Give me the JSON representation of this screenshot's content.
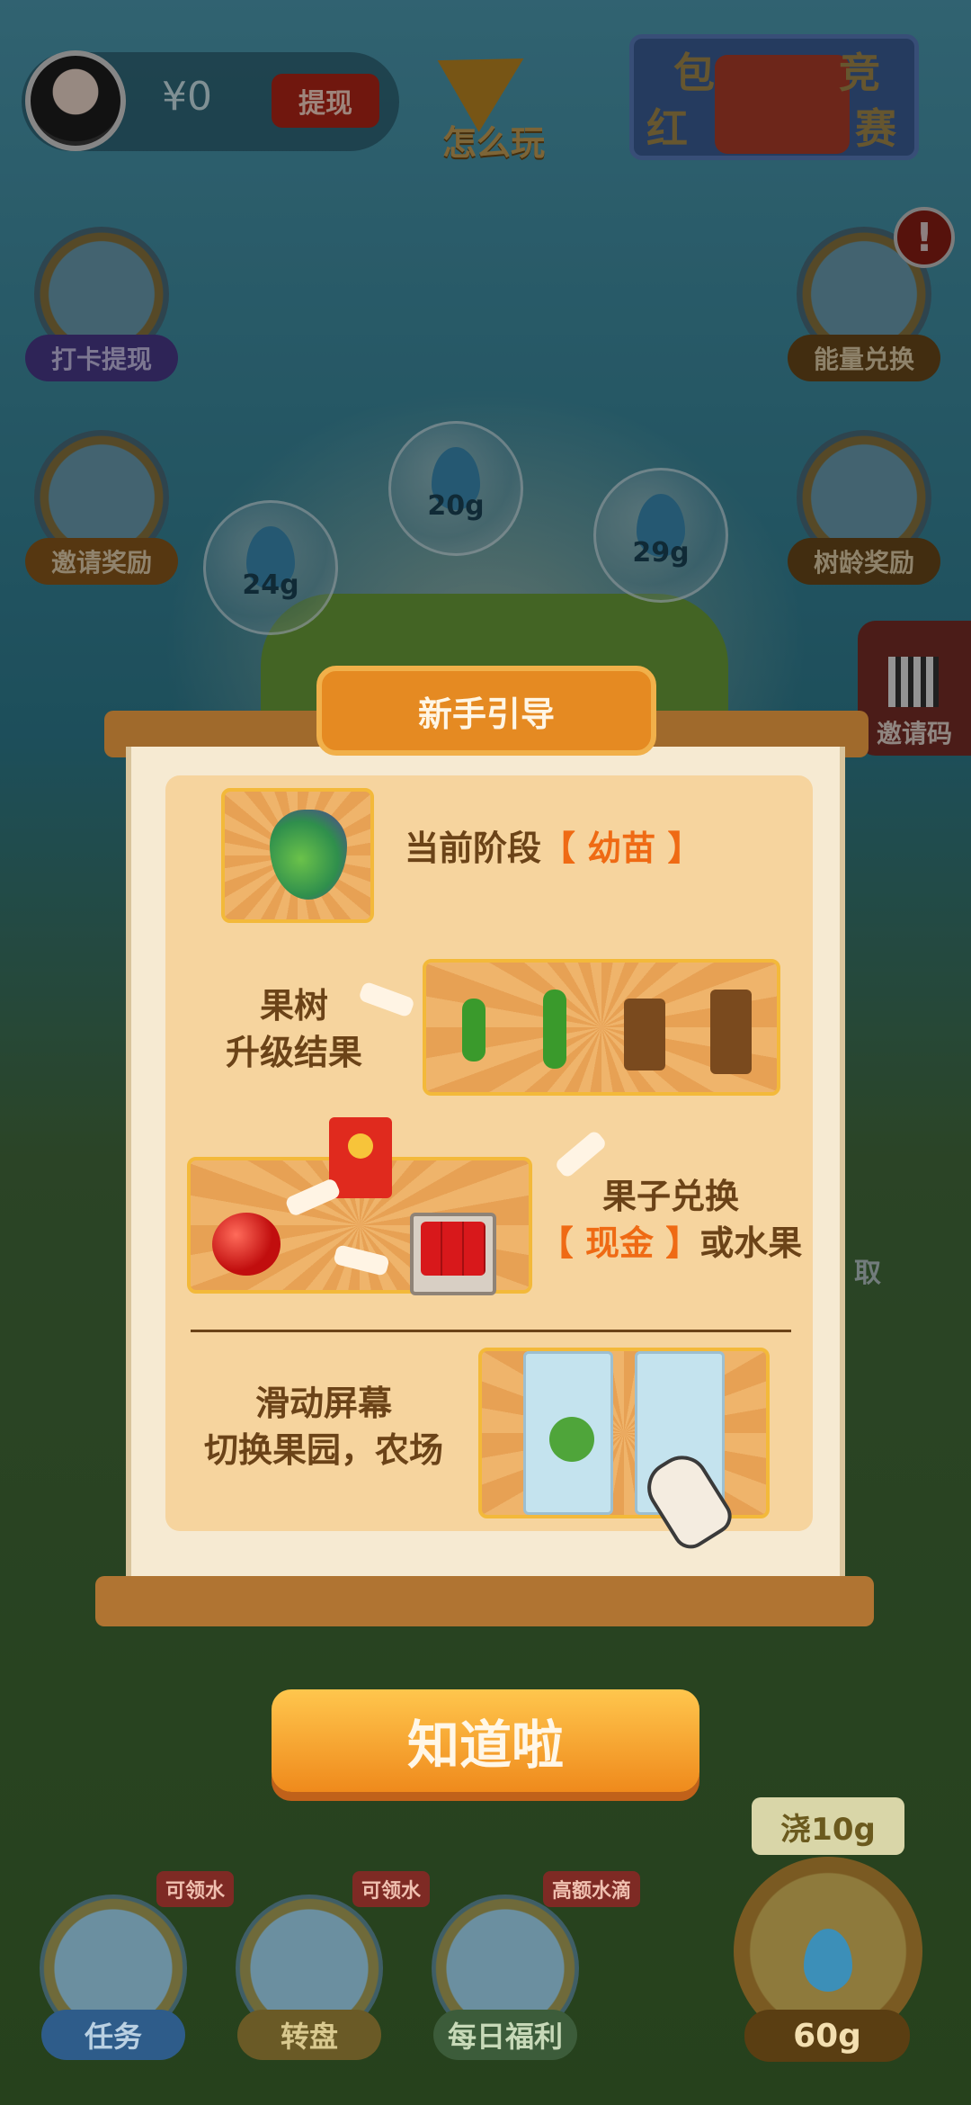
{
  "header": {
    "balance": "¥0",
    "withdraw_label": "提现",
    "how_to_play_label": "怎么玩",
    "contest_chars": [
      "包",
      "红",
      "竞",
      "赛"
    ]
  },
  "left_side": {
    "checkin_label": "打卡提现",
    "invite_label": "邀请奖励"
  },
  "right_side": {
    "energy_label": "能量兑换",
    "alert_mark": "!",
    "tree_age_label": "树龄奖励",
    "invite_code_label": "邀请码",
    "peek_text": "取"
  },
  "bubbles": [
    "20g",
    "29g",
    "24g"
  ],
  "guide": {
    "title": "新手引导",
    "stage_prefix": "当前阶段",
    "stage_value": "【 幼苗 】",
    "step2_line1": "果树",
    "step2_line2": "升级结果",
    "step3_line1": "果子兑换",
    "step3_line2_highlight": "【 现金 】",
    "step3_line2_rest": "或水果",
    "step4_line1": "滑动屏幕",
    "step4_line2": "切换果园，农场",
    "confirm_label": "知道啦"
  },
  "bottom_nav": {
    "tasks_label": "任务",
    "tasks_tag": "可领水",
    "wheel_label": "转盘",
    "wheel_tag": "可领水",
    "daily_label": "每日福利",
    "daily_tag": "高额水滴",
    "water_action": "浇10g",
    "water_amount": "60g"
  },
  "colors": {
    "accent_orange": "#ef6a14",
    "button_orange": "#ef8a1c",
    "panel_bg": "#f6ead2"
  }
}
